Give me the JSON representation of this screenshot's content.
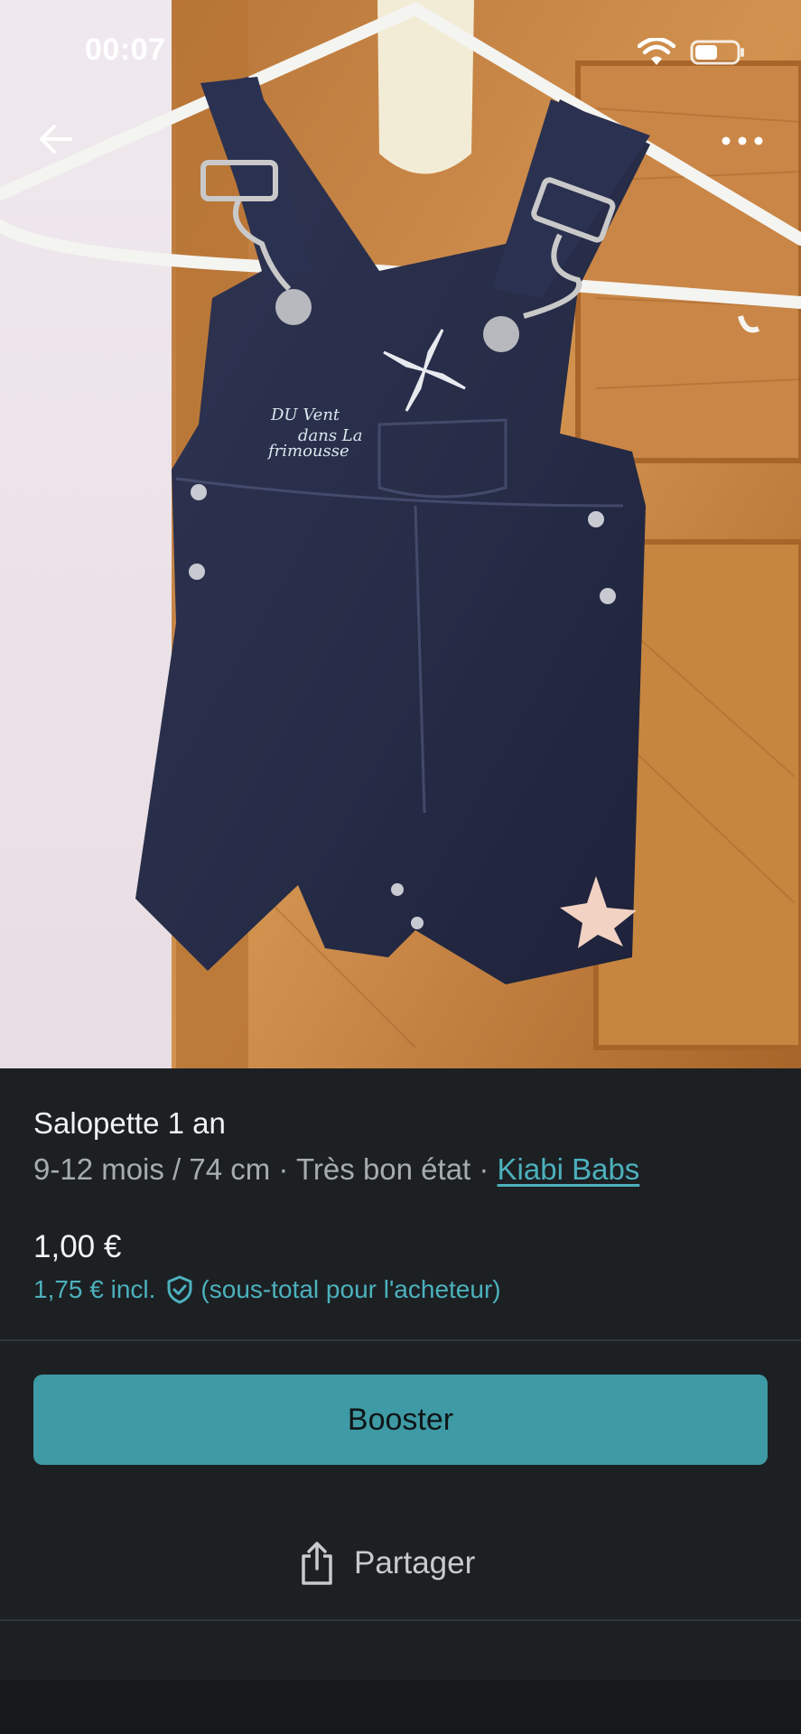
{
  "status_bar": {
    "time": "00:07",
    "wifi_icon": "wifi-icon",
    "battery_icon": "battery-icon"
  },
  "top_bar": {
    "back_icon": "arrow-left-icon",
    "more_icon": "more-horizontal-icon"
  },
  "photo": {
    "embroidery_line1": "DU Vent",
    "embroidery_line2": "dans La",
    "embroidery_line3": "frimousse"
  },
  "item": {
    "title": "Salopette 1 an",
    "size": "9-12 mois / 74 cm",
    "separator": " · ",
    "condition": "Très bon état",
    "brand": "Kiabi Babs",
    "price": "1,00 €",
    "price_incl": "1,75 € incl.",
    "price_incl_note": "(sous-total pour l'acheteur)"
  },
  "actions": {
    "booster_label": "Booster",
    "share_label": "Partager",
    "share_icon": "share-icon"
  },
  "colors": {
    "background": "#1c2023",
    "accent": "#3e9aa5",
    "link": "#4cb1bd",
    "text_secondary": "#a7adaf"
  }
}
